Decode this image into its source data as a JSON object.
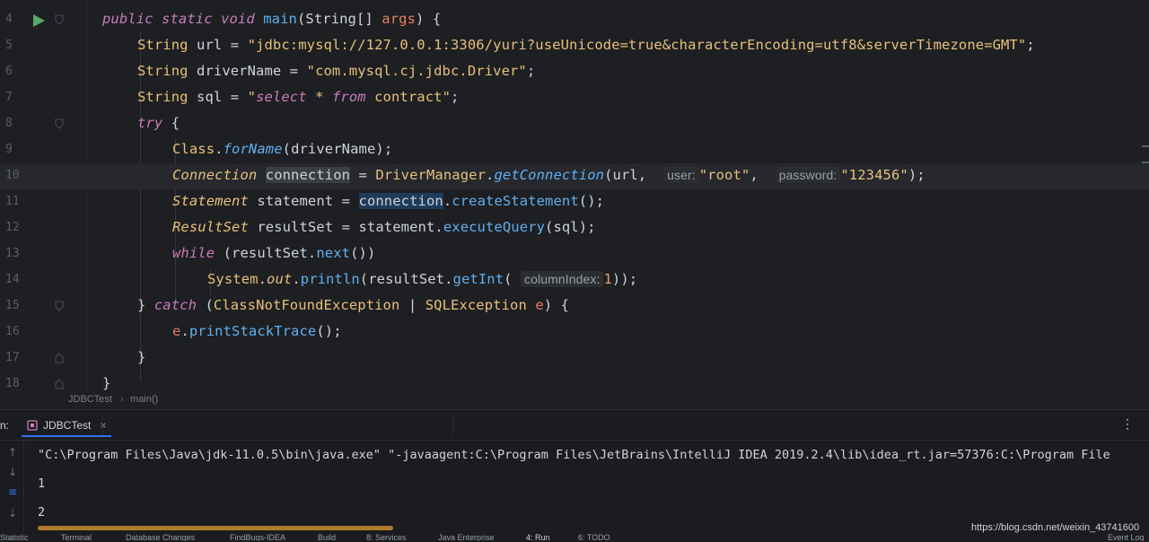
{
  "editor": {
    "lines": [
      {
        "num": "4"
      },
      {
        "num": "5"
      },
      {
        "num": "6"
      },
      {
        "num": "7"
      },
      {
        "num": "8"
      },
      {
        "num": "9"
      },
      {
        "num": "10"
      },
      {
        "num": "11"
      },
      {
        "num": "12"
      },
      {
        "num": "13"
      },
      {
        "num": "14"
      },
      {
        "num": "15"
      },
      {
        "num": "16"
      },
      {
        "num": "17"
      },
      {
        "num": "18"
      }
    ],
    "code": {
      "l4_public": "public",
      "l4_static": "static",
      "l4_void": "void",
      "l4_main": "main",
      "l4_rest": "(String[] ",
      "l4_args": "args",
      "l4_end": ") {",
      "l5_type": "String",
      "l5_var": " url = ",
      "l5_str": "\"jdbc:mysql://127.0.0.1:3306/yuri?useUnicode=true&characterEncoding=utf8&serverTimezone=GMT\"",
      "l5_end": ";",
      "l6_type": "String",
      "l6_var": " driverName = ",
      "l6_str": "\"com.mysql.cj.jdbc.Driver\"",
      "l6_end": ";",
      "l7_type": "String",
      "l7_var": " sql = ",
      "l7_q1": "\"",
      "l7_sel": "select",
      "l7_star": " * ",
      "l7_from": "from",
      "l7_tbl": " contract",
      "l7_q2": "\"",
      "l7_end": ";",
      "l8_try": "try",
      "l8_end": " {",
      "l9_class": "Class",
      "l9_dot": ".",
      "l9_forname": "forName",
      "l9_args": "(driverName);",
      "l10_type": "Connection",
      "l10_var": "connection",
      "l10_eq": " = ",
      "l10_dm": "DriverManager",
      "l10_dot": ".",
      "l10_gc": "getConnection",
      "l10_url": "(url, ",
      "l10_hint_user": "user:",
      "l10_root": "\"root\"",
      "l10_comma": ", ",
      "l10_hint_pw": "password:",
      "l10_pw": "\"123456\"",
      "l10_end": ");",
      "l11_type": "Statement",
      "l11_var": " statement = ",
      "l11_conn": "connection",
      "l11_dot": ".",
      "l11_cs": "createStatement",
      "l11_end": "();",
      "l12_type": "ResultSet",
      "l12_var": " resultSet = statement.",
      "l12_eq": "executeQuery",
      "l12_end": "(sql);",
      "l13_while": "while",
      "l13_open": " (resultSet.",
      "l13_next": "next",
      "l13_end": "())",
      "l14_sys": "System",
      "l14_dot": ".",
      "l14_out": "out",
      "l14_dot2": ".",
      "l14_println": "println",
      "l14_rs": "(resultSet.",
      "l14_getint": "getInt",
      "l14_paren": "(",
      "l14_hint": "columnIndex:",
      "l14_num": "1",
      "l14_end": "));",
      "l15_close": "} ",
      "l15_catch": "catch",
      "l15_open": " (",
      "l15_cnfe": "ClassNotFoundException",
      "l15_bar": " | ",
      "l15_sqle": "SQLException",
      "l15_e": " e",
      "l15_end": ") {",
      "l16_e": "e",
      "l16_dot": ".",
      "l16_pst": "printStackTrace",
      "l16_end": "();",
      "l17_close": "}",
      "l18_close": "}"
    }
  },
  "breadcrumb": {
    "class_name": "JDBCTest",
    "method_name": "main()"
  },
  "run_panel": {
    "prefix": "n:",
    "tab_label": "JDBCTest",
    "tab_close": "×",
    "more_icon": "⋮",
    "output_lines": [
      "\"C:\\Program Files\\Java\\jdk-11.0.5\\bin\\java.exe\" \"-javaagent:C:\\Program Files\\JetBrains\\IntelliJ IDEA 2019.2.4\\lib\\idea_rt.jar=57376:C:\\Program File",
      "1",
      "2"
    ]
  },
  "statusbar": {
    "items": [
      "Statistic",
      "Terminal",
      "Database Changes",
      "FindBugs-IDEA",
      "Build",
      "8: Services",
      "Java Enterprise",
      "4: Run",
      "6: TODO",
      "Event Log"
    ]
  },
  "watermark": "https://blog.csdn.net/weixin_43741600",
  "colors": {
    "background": "#1e1f22",
    "keyword": "#c77dbb",
    "string": "#e6c07b",
    "method": "#61afef",
    "scrollbar": "#b07b2d",
    "run_icon": "#59a869"
  }
}
